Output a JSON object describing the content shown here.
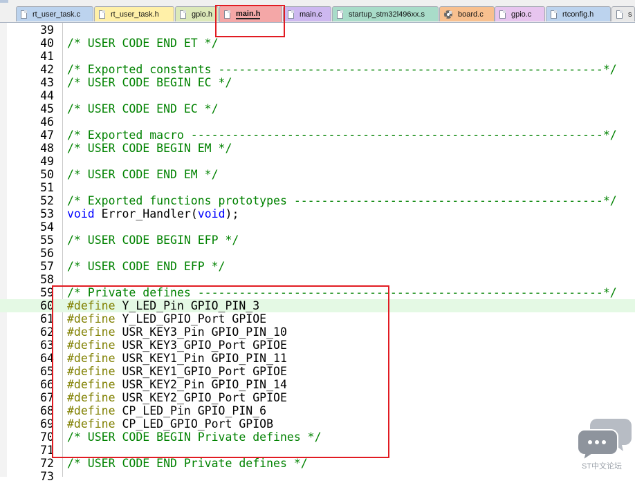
{
  "tabs": [
    {
      "label": "rt_user_task.c",
      "color": "#bcd3ee",
      "icon": "file-icon"
    },
    {
      "label": "rt_user_task.h",
      "color": "#fff0a8",
      "icon": "file-icon"
    },
    {
      "label": "gpio.h",
      "color": "#dce9b9",
      "icon": "file-icon"
    },
    {
      "label": "main.h",
      "color": "#f4a7a7",
      "icon": "file-icon",
      "active": true
    },
    {
      "label": "main.c",
      "color": "#cdb8f0",
      "icon": "file-icon"
    },
    {
      "label": "startup_stm32l496xx.s",
      "color": "#a9dcc9",
      "icon": "file-icon"
    },
    {
      "label": "board.c",
      "color": "#f8c08f",
      "icon": "gear-file-icon"
    },
    {
      "label": "gpio.c",
      "color": "#e7c5ef",
      "icon": "file-icon"
    },
    {
      "label": "rtconfig.h",
      "color": "#bcd3ee",
      "icon": "file-icon"
    },
    {
      "label": "s",
      "color": "#e8e8e8",
      "icon": "file-icon"
    }
  ],
  "editor": {
    "current_line": 60,
    "lines": [
      {
        "n": "39",
        "t": []
      },
      {
        "n": "40",
        "t": [
          [
            "cm",
            "/* USER CODE END ET */"
          ]
        ]
      },
      {
        "n": "41",
        "t": []
      },
      {
        "n": "42",
        "t": [
          [
            "cm",
            "/* Exported constants --------------------------------------------------------*/"
          ]
        ]
      },
      {
        "n": "43",
        "t": [
          [
            "cm",
            "/* USER CODE BEGIN EC */"
          ]
        ]
      },
      {
        "n": "44",
        "t": []
      },
      {
        "n": "45",
        "t": [
          [
            "cm",
            "/* USER CODE END EC */"
          ]
        ]
      },
      {
        "n": "46",
        "t": []
      },
      {
        "n": "47",
        "t": [
          [
            "cm",
            "/* Exported macro ------------------------------------------------------------*/"
          ]
        ]
      },
      {
        "n": "48",
        "t": [
          [
            "cm",
            "/* USER CODE BEGIN EM */"
          ]
        ]
      },
      {
        "n": "49",
        "t": []
      },
      {
        "n": "50",
        "t": [
          [
            "cm",
            "/* USER CODE END EM */"
          ]
        ]
      },
      {
        "n": "51",
        "t": []
      },
      {
        "n": "52",
        "t": [
          [
            "cm",
            "/* Exported functions prototypes ---------------------------------------------*/"
          ]
        ]
      },
      {
        "n": "53",
        "t": [
          [
            "kw",
            "void"
          ],
          [
            "tx",
            " Error_Handler("
          ],
          [
            "kw",
            "void"
          ],
          [
            "tx",
            ");"
          ]
        ]
      },
      {
        "n": "54",
        "t": []
      },
      {
        "n": "55",
        "t": [
          [
            "cm",
            "/* USER CODE BEGIN EFP */"
          ]
        ]
      },
      {
        "n": "56",
        "t": []
      },
      {
        "n": "57",
        "t": [
          [
            "cm",
            "/* USER CODE END EFP */"
          ]
        ]
      },
      {
        "n": "58",
        "t": []
      },
      {
        "n": "59",
        "t": [
          [
            "cm",
            "/* Private defines -----------------------------------------------------------*/"
          ]
        ]
      },
      {
        "n": "60",
        "t": [
          [
            "pp",
            "#define"
          ],
          [
            "tx",
            " Y_LED_Pin GPIO_PIN_3"
          ]
        ]
      },
      {
        "n": "61",
        "t": [
          [
            "pp",
            "#define"
          ],
          [
            "tx",
            " Y_LED_GPIO_Port GPIOE"
          ]
        ]
      },
      {
        "n": "62",
        "t": [
          [
            "pp",
            "#define"
          ],
          [
            "tx",
            " USR_KEY3_Pin GPIO_PIN_10"
          ]
        ]
      },
      {
        "n": "63",
        "t": [
          [
            "pp",
            "#define"
          ],
          [
            "tx",
            " USR_KEY3_GPIO_Port GPIOE"
          ]
        ]
      },
      {
        "n": "64",
        "t": [
          [
            "pp",
            "#define"
          ],
          [
            "tx",
            " USR_KEY1_Pin GPIO_PIN_11"
          ]
        ]
      },
      {
        "n": "65",
        "t": [
          [
            "pp",
            "#define"
          ],
          [
            "tx",
            " USR_KEY1_GPIO_Port GPIOE"
          ]
        ]
      },
      {
        "n": "66",
        "t": [
          [
            "pp",
            "#define"
          ],
          [
            "tx",
            " USR_KEY2_Pin GPIO_PIN_14"
          ]
        ]
      },
      {
        "n": "67",
        "t": [
          [
            "pp",
            "#define"
          ],
          [
            "tx",
            " USR_KEY2_GPIO_Port GPIOE"
          ]
        ]
      },
      {
        "n": "68",
        "t": [
          [
            "pp",
            "#define"
          ],
          [
            "tx",
            " CP_LED_Pin GPIO_PIN_6"
          ]
        ]
      },
      {
        "n": "69",
        "t": [
          [
            "pp",
            "#define"
          ],
          [
            "tx",
            " CP_LED_GPIO_Port GPIOB"
          ]
        ]
      },
      {
        "n": "70",
        "t": [
          [
            "cm",
            "/* USER CODE BEGIN Private defines */"
          ]
        ]
      },
      {
        "n": "71",
        "t": []
      },
      {
        "n": "72",
        "t": [
          [
            "cm",
            "/* USER CODE END Private defines */"
          ]
        ]
      },
      {
        "n": "73",
        "t": []
      }
    ]
  },
  "annotations": {
    "highlight_color": "#e11b22"
  },
  "watermark": {
    "text": "ST中文论坛",
    "icon": "chat-bubbles-icon"
  }
}
